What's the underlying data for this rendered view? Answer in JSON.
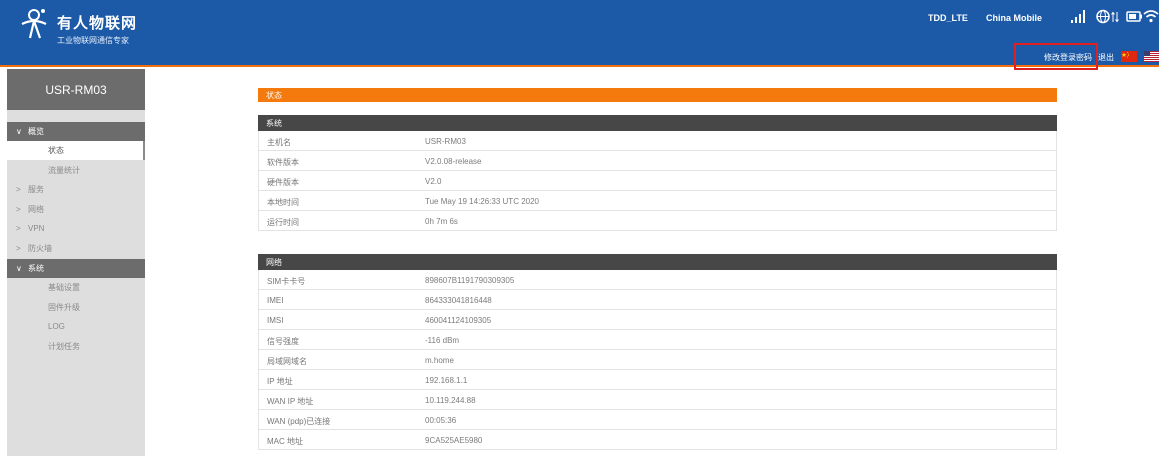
{
  "brand": {
    "name": "有人物联网",
    "subtitle": "工业物联网通信专家"
  },
  "header": {
    "network_type": "TDD_LTE",
    "carrier": "China Mobile",
    "change_password": "修改登录密码",
    "logout": "退出"
  },
  "icons": {
    "signal": "signal-bars-icon",
    "globe": "globe-data-icon",
    "battery": "battery-icon",
    "wifi": "wifi-icon",
    "flag_cn": "china-flag-icon",
    "flag_us": "us-flag-icon"
  },
  "colors": {
    "header": "#1c5aa7",
    "accent": "#f47a0e",
    "section_head": "#474747",
    "sidebar": "#dedede",
    "highlight": "#e02020"
  },
  "sidebar": {
    "device": "USR-RM03",
    "items": [
      {
        "label": "概览",
        "chevron": "∨"
      },
      {
        "label": "状态"
      },
      {
        "label": "流量统计"
      },
      {
        "label": "服务",
        "chevron": ">"
      },
      {
        "label": "网络",
        "chevron": ">"
      },
      {
        "label": "VPN",
        "chevron": ">"
      },
      {
        "label": "防火墙",
        "chevron": ">"
      },
      {
        "label": "系统",
        "chevron": "∨"
      },
      {
        "label": "基础设置"
      },
      {
        "label": "固件升级"
      },
      {
        "label": "LOG"
      },
      {
        "label": "计划任务"
      }
    ]
  },
  "main": {
    "status_title": "状态",
    "system": {
      "title": "系统",
      "rows": [
        {
          "label": "主机名",
          "value": "USR-RM03"
        },
        {
          "label": "软件版本",
          "value": "V2.0.08-release"
        },
        {
          "label": "硬件版本",
          "value": "V2.0"
        },
        {
          "label": "本地时间",
          "value": "Tue May 19 14:26:33 UTC 2020"
        },
        {
          "label": "运行时间",
          "value": "0h 7m 6s"
        }
      ]
    },
    "network": {
      "title": "网络",
      "rows": [
        {
          "label": "SIM卡卡号",
          "value": "898607B1191790309305"
        },
        {
          "label": "IMEI",
          "value": "864333041816448"
        },
        {
          "label": "IMSI",
          "value": "460041124109305"
        },
        {
          "label": "信号强度",
          "value": "-116 dBm"
        },
        {
          "label": "局域网域名",
          "value": "m.home"
        },
        {
          "label": "IP 地址",
          "value": "192.168.1.1"
        },
        {
          "label": "WAN IP 地址",
          "value": "10.119.244.88"
        },
        {
          "label": "WAN (pdp)已连接",
          "value": "00:05:36"
        },
        {
          "label": "MAC 地址",
          "value": "9CA525AE5980"
        }
      ]
    }
  }
}
